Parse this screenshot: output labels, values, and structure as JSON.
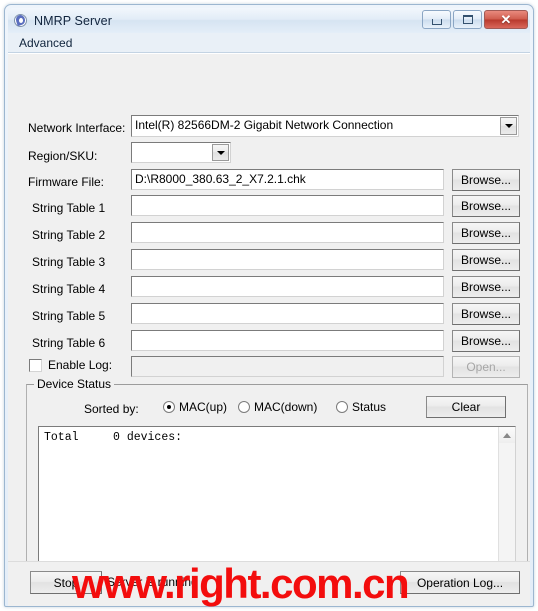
{
  "window": {
    "title": "NMRP Server",
    "icon": "nmrp-app-icon",
    "minimize_label": "–",
    "maximize_label": "□",
    "close_label": "✕"
  },
  "menu": {
    "items": [
      {
        "label": "Advanced"
      }
    ]
  },
  "form": {
    "network_interface": {
      "label": "Network Interface:",
      "value": "Intel(R) 82566DM-2 Gigabit Network Connection"
    },
    "region_sku": {
      "label": "Region/SKU:",
      "value": ""
    },
    "firmware_file": {
      "label": "Firmware File:",
      "value": "D:\\R8000_380.63_2_X7.2.1.chk",
      "browse_label": "Browse..."
    },
    "string_tables": [
      {
        "label": "String Table  1",
        "value": "",
        "browse_label": "Browse..."
      },
      {
        "label": "String Table  2",
        "value": "",
        "browse_label": "Browse..."
      },
      {
        "label": "String Table  3",
        "value": "",
        "browse_label": "Browse..."
      },
      {
        "label": "String Table  4",
        "value": "",
        "browse_label": "Browse..."
      },
      {
        "label": "String Table  5",
        "value": "",
        "browse_label": "Browse..."
      },
      {
        "label": "String Table  6",
        "value": "",
        "browse_label": "Browse..."
      }
    ],
    "enable_log": {
      "label": "Enable Log:",
      "checked": false,
      "value": "",
      "open_label": "Open...",
      "open_disabled": true
    }
  },
  "device_status": {
    "legend": "Device Status",
    "sorted_by_label": "Sorted by:",
    "sort_options": [
      {
        "label": "MAC(up)",
        "selected": true
      },
      {
        "label": "MAC(down)",
        "selected": false
      },
      {
        "label": "Status",
        "selected": false
      }
    ],
    "clear_label": "Clear",
    "list_text": "Total     0 devices:"
  },
  "status_bar": {
    "stop_label": "Stop",
    "status_text": "Server is running",
    "operation_log_label": "Operation Log..."
  },
  "watermark": {
    "text": "www.right.com.cn",
    "color": "#f30d0d"
  }
}
